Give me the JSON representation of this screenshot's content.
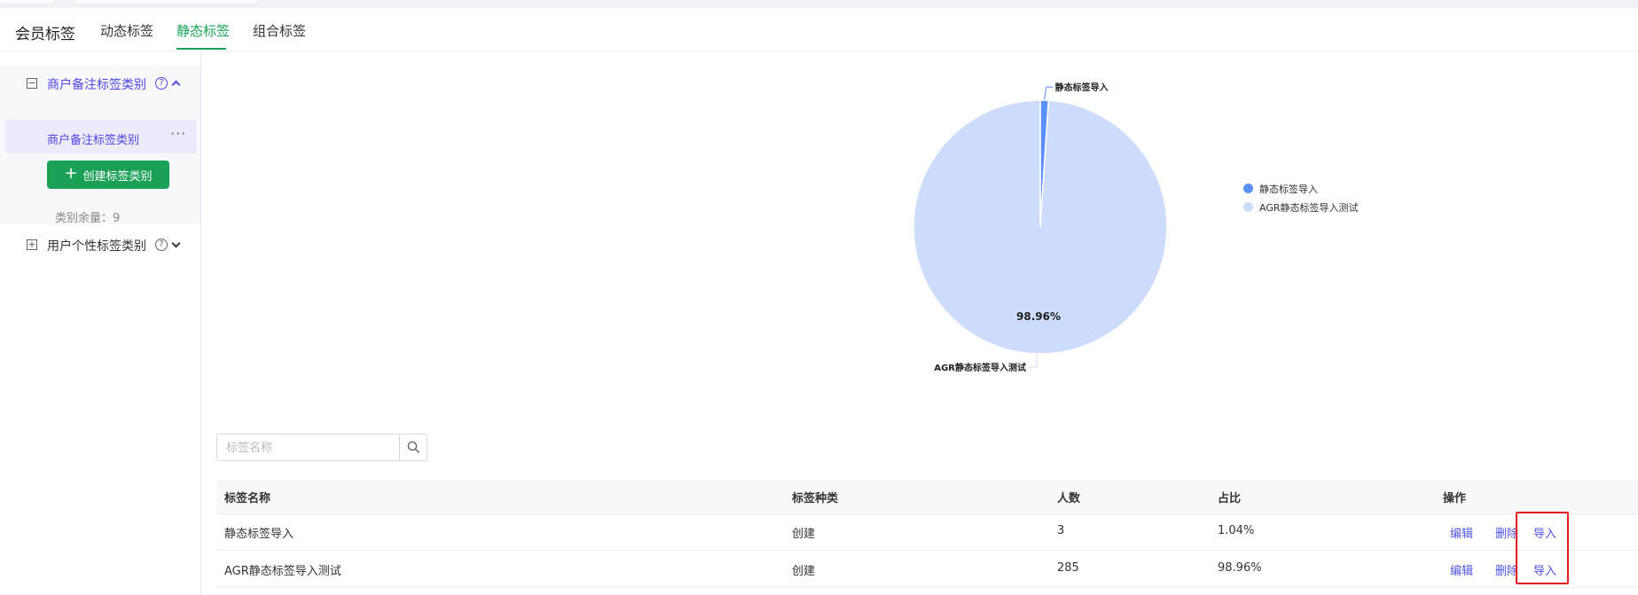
{
  "page": {
    "title": "会员标签"
  },
  "tabs": [
    {
      "label": "动态标签"
    },
    {
      "label": "静态标签"
    },
    {
      "label": "组合标签"
    }
  ],
  "sidebar": {
    "groups": [
      {
        "label": "商户备注标签类别",
        "expanded": true,
        "items": [
          {
            "label": "商户备注标签类别",
            "more": "···"
          }
        ],
        "create_button": "创建标签类别",
        "remain_text": "类别余量：9"
      },
      {
        "label": "用户个性标签类别",
        "expanded": false
      }
    ]
  },
  "colors": {
    "accent": "#1aa157",
    "link": "#4f55e6",
    "slice_primary": "#5b8ff9",
    "slice_secondary": "#cddcfd",
    "highlight": "#e02020"
  },
  "chart_data": {
    "type": "pie",
    "slices": [
      {
        "label": "静态标签导入",
        "value": 3,
        "percent": 1.04
      },
      {
        "label": "AGR静态标签导入测试",
        "value": 285,
        "percent": 98.96
      }
    ],
    "center_label": "98.96%",
    "legend": {
      "position": "right",
      "items": [
        "静态标签导入",
        "AGR静态标签导入测试"
      ]
    }
  },
  "search": {
    "placeholder": "标签名称"
  },
  "table": {
    "columns": [
      "标签名称",
      "标签种类",
      "人数",
      "占比",
      "操作"
    ],
    "rows": [
      {
        "name": "静态标签导入",
        "kind": "创建",
        "count": "3",
        "ratio": "1.04%"
      },
      {
        "name": "AGR静态标签导入测试",
        "kind": "创建",
        "count": "285",
        "ratio": "98.96%"
      }
    ],
    "actions": {
      "edit": "编辑",
      "delete": "删除",
      "import": "导入"
    }
  }
}
